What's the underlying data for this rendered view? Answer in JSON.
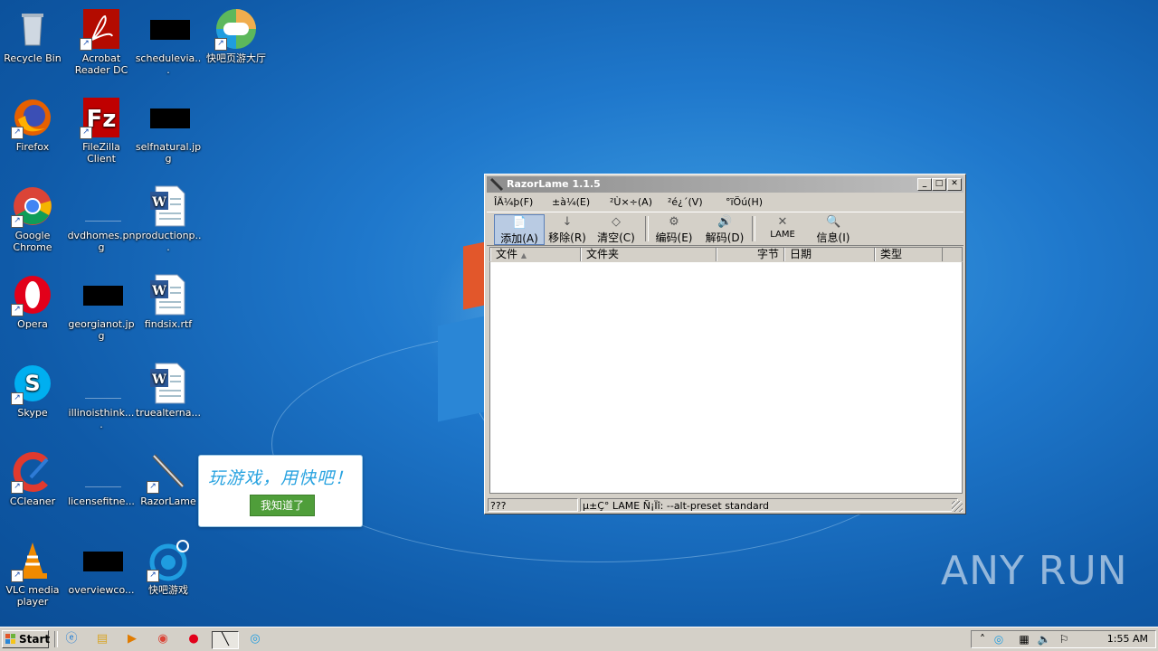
{
  "desktop": {
    "icons": [
      {
        "label": "Recycle Bin"
      },
      {
        "label": "Acrobat Reader DC"
      },
      {
        "label": "scheduleviа..."
      },
      {
        "label": "快吧页游大厅"
      },
      {
        "label": "Firefox"
      },
      {
        "label": "FileZilla Client"
      },
      {
        "label": "selfnatural.jpg"
      },
      {
        "label": "Google Chrome"
      },
      {
        "label": "dvdhomes.png"
      },
      {
        "label": "productionp..."
      },
      {
        "label": "Opera"
      },
      {
        "label": "georgianot.jpg"
      },
      {
        "label": "findsix.rtf"
      },
      {
        "label": "Skype"
      },
      {
        "label": "illinoisthink...."
      },
      {
        "label": "truealterna..."
      },
      {
        "label": "CCleaner"
      },
      {
        "label": "licensefitne..."
      },
      {
        "label": "RazorLame"
      },
      {
        "label": "VLC media player"
      },
      {
        "label": "overviewco..."
      },
      {
        "label": "快吧游戏"
      }
    ]
  },
  "popup": {
    "title": "玩游戏，用快吧！",
    "button": "我知道了"
  },
  "window": {
    "title": "RazorLame 1.1.5",
    "menu": [
      "ÎÄ¼þ(F)",
      "±à¼­(E)",
      "²Ù×÷(A)",
      "²é¿´(V)",
      "°ïÖú(H)"
    ],
    "toolbar": [
      {
        "label": "添加(A)"
      },
      {
        "label": "移除(R)"
      },
      {
        "label": "清空(C)"
      },
      {
        "label": "编码(E)"
      },
      {
        "label": "解码(D)"
      },
      {
        "label": "LAME"
      },
      {
        "label": "信息(I)"
      }
    ],
    "columns": [
      "文件",
      "文件夹",
      "字节",
      "日期",
      "类型"
    ],
    "status": {
      "left": "???",
      "right": "µ±Ç° LAME Ñ¡Ïî:  --alt-preset standard"
    }
  },
  "taskbar": {
    "start": "Start",
    "clock": "1:55 AM"
  },
  "watermark": "ANY RUN"
}
